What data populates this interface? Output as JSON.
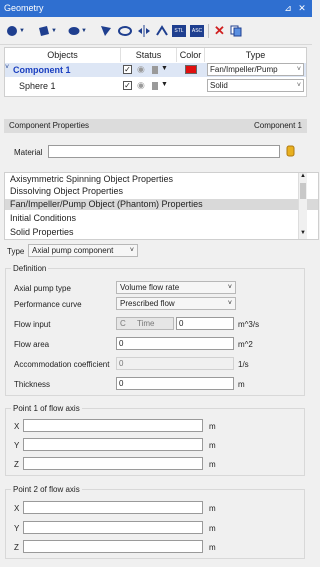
{
  "window": {
    "title": "Geometry"
  },
  "toolbar": {
    "stl": "STL",
    "asc": "ASC"
  },
  "grid": {
    "headers": {
      "objects": "Objects",
      "status": "Status",
      "color": "Color",
      "type": "Type"
    },
    "rows": [
      {
        "name": "Component 1",
        "type": "Fan/Impeller/Pump",
        "color": "#e01010"
      },
      {
        "name": "Sphere 1",
        "type": "Solid"
      }
    ]
  },
  "component_bar": {
    "left": "Component Properties",
    "right": "Component 1"
  },
  "material": {
    "label": "Material",
    "value": ""
  },
  "properties_list": [
    "Axisymmetric Spinning Object Properties",
    "Dissolving Object Properties",
    "Fan/Impeller/Pump Object (Phantom) Properties",
    "Initial Conditions",
    "Solid Properties"
  ],
  "type_row": {
    "label": "Type",
    "value": "Axial pump component"
  },
  "definition": {
    "title": "Definition",
    "axial_pump_type": {
      "label": "Axial pump type",
      "value": "Volume flow rate"
    },
    "performance_curve": {
      "label": "Performance curve",
      "value": "Prescribed flow"
    },
    "flow_input": {
      "label": "Flow input",
      "c": "C",
      "time": "Time",
      "value": "0",
      "unit": "m^3/s"
    },
    "flow_area": {
      "label": "Flow area",
      "value": "0",
      "unit": "m^2"
    },
    "accommodation": {
      "label": "Accommodation coefficient",
      "value": "0",
      "unit": "1/s"
    },
    "thickness": {
      "label": "Thickness",
      "value": "0",
      "unit": "m"
    }
  },
  "point1": {
    "title": "Point 1 of flow axis",
    "x": {
      "label": "X",
      "value": "",
      "unit": "m"
    },
    "y": {
      "label": "Y",
      "value": "",
      "unit": "m"
    },
    "z": {
      "label": "Z",
      "value": "",
      "unit": "m"
    }
  },
  "point2": {
    "title": "Point 2 of flow axis",
    "x": {
      "label": "X",
      "value": "",
      "unit": "m"
    },
    "y": {
      "label": "Y",
      "value": "",
      "unit": "m"
    },
    "z": {
      "label": "Z",
      "value": "",
      "unit": "m"
    }
  }
}
